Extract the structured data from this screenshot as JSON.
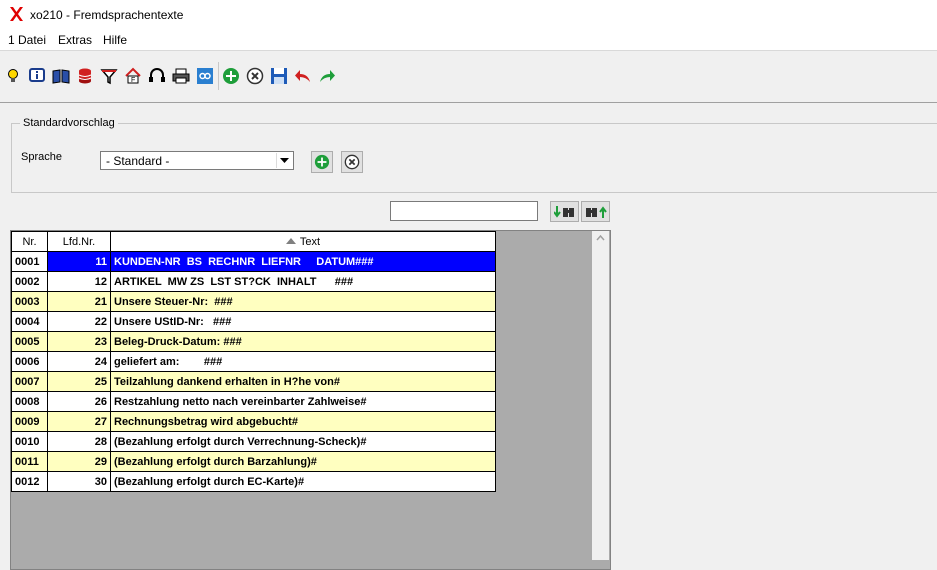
{
  "window": {
    "title": "xo210 - Fremdsprachentexte"
  },
  "menu": [
    "1 Datei",
    "Extras",
    "Hilfe"
  ],
  "toolbar_icons": [
    "lightbulb-icon",
    "info-icon",
    "book-icon",
    "database-icon",
    "filter-icon",
    "home-icon",
    "headset-icon",
    "printer-icon",
    "link-icon",
    "add-icon",
    "delete-icon",
    "save-icon",
    "undo-icon",
    "redo-icon"
  ],
  "standard": {
    "group_title": "Standardvorschlag",
    "sprache_label": "Sprache",
    "sprache_value": "- Standard -"
  },
  "search": {
    "value": ""
  },
  "grid": {
    "columns": [
      "Nr.",
      "Lfd.Nr.",
      "Text"
    ],
    "sort_column": "Text",
    "rows": [
      {
        "nr": "0001",
        "lfd": "11",
        "text": "KUNDEN-NR  BS  RECHNR  LIEFNR     DATUM###",
        "style": "selected"
      },
      {
        "nr": "0002",
        "lfd": "12",
        "text": "ARTIKEL  MW ZS  LST ST?CK  INHALT      ###",
        "style": "white"
      },
      {
        "nr": "0003",
        "lfd": "21",
        "text": "Unsere Steuer-Nr:  ###",
        "style": "yellow"
      },
      {
        "nr": "0004",
        "lfd": "22",
        "text": "Unsere UStID-Nr:   ###",
        "style": "white"
      },
      {
        "nr": "0005",
        "lfd": "23",
        "text": "Beleg-Druck-Datum: ###",
        "style": "yellow"
      },
      {
        "nr": "0006",
        "lfd": "24",
        "text": "geliefert am:        ###",
        "style": "white"
      },
      {
        "nr": "0007",
        "lfd": "25",
        "text": "Teilzahlung dankend erhalten in H?he von#",
        "style": "yellow"
      },
      {
        "nr": "0008",
        "lfd": "26",
        "text": "Restzahlung netto nach vereinbarter Zahlweise#",
        "style": "white"
      },
      {
        "nr": "0009",
        "lfd": "27",
        "text": "Rechnungsbetrag wird abgebucht#",
        "style": "yellow"
      },
      {
        "nr": "0010",
        "lfd": "28",
        "text": "(Bezahlung erfolgt durch Verrechnung-Scheck)#",
        "style": "white"
      },
      {
        "nr": "0011",
        "lfd": "29",
        "text": "(Bezahlung erfolgt durch Barzahlung)#",
        "style": "yellow"
      },
      {
        "nr": "0012",
        "lfd": "30",
        "text": "(Bezahlung erfolgt durch EC-Karte)#",
        "style": "white"
      }
    ]
  },
  "colors": {
    "selected_row": "#0000ff",
    "alt_row": "#ffffc0",
    "logo": "#e00000"
  }
}
